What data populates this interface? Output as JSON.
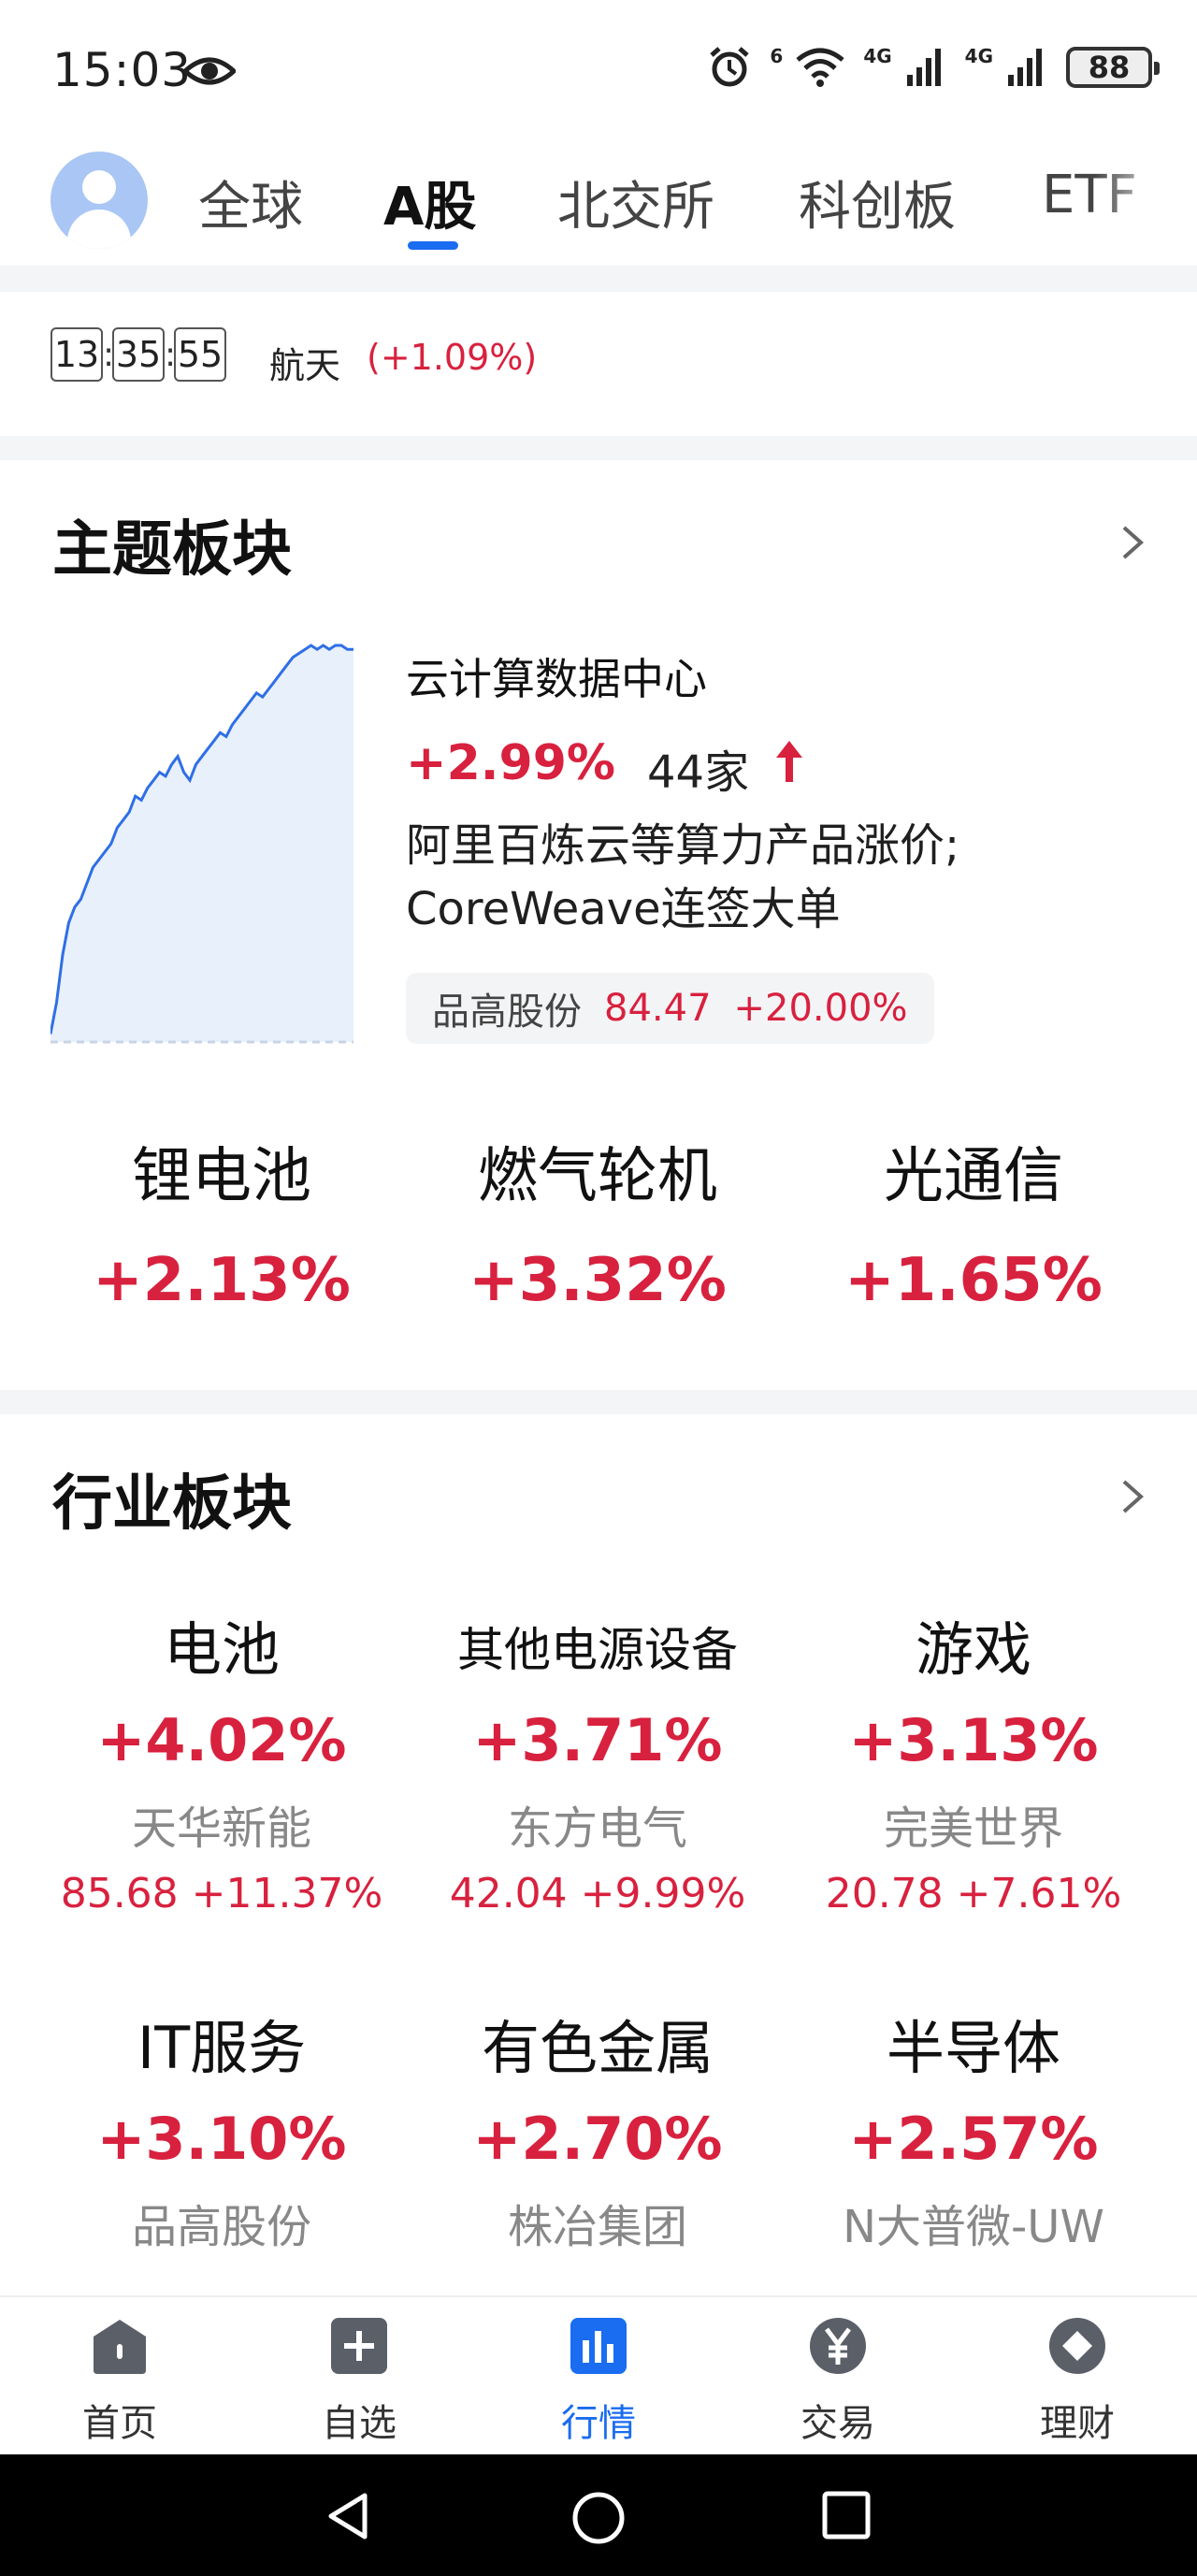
{
  "status_bar": {
    "time": "15:03",
    "signal_label_1": "4G",
    "signal_label_2": "4G",
    "wifi_label": "6",
    "battery": "88"
  },
  "tabs": [
    {
      "label": "全球"
    },
    {
      "label": "A股"
    },
    {
      "label": "北交所"
    },
    {
      "label": "科创板"
    },
    {
      "label": "ETF"
    }
  ],
  "ticker": {
    "clock_h": "13",
    "clock_m": "35",
    "clock_s": "55",
    "name": "航天",
    "change": "(+1.09%)"
  },
  "theme": {
    "title": "主题板块",
    "featured": {
      "name": "云计算数据中心",
      "change": "+2.99%",
      "count": "44家",
      "desc_line1": "阿里百炼云等算力产品涨价;",
      "desc_line2": "CoreWeave连签大单",
      "stock_name": "品高股份",
      "stock_price": "84.47",
      "stock_change": "+20.00%"
    },
    "others": [
      {
        "name": "锂电池",
        "change": "+2.13%"
      },
      {
        "name": "燃气轮机",
        "change": "+3.32%"
      },
      {
        "name": "光通信",
        "change": "+1.65%"
      }
    ]
  },
  "industry": {
    "title": "行业板块",
    "items": [
      {
        "name": "电池",
        "change": "+4.02%",
        "leader": "天华新能",
        "leader_price": "85.68 +11.37%"
      },
      {
        "name": "其他电源设备",
        "change": "+3.71%",
        "leader": "东方电气",
        "leader_price": "42.04 +9.99%"
      },
      {
        "name": "游戏",
        "change": "+3.13%",
        "leader": "完美世界",
        "leader_price": "20.78 +7.61%"
      },
      {
        "name": "IT服务",
        "change": "+3.10%",
        "leader": "品高股份",
        "leader_price": ""
      },
      {
        "name": "有色金属",
        "change": "+2.70%",
        "leader": "株冶集团",
        "leader_price": ""
      },
      {
        "name": "半导体",
        "change": "+2.57%",
        "leader": "N大普微-UW",
        "leader_price": ""
      }
    ]
  },
  "bottom_nav": [
    {
      "label": "首页"
    },
    {
      "label": "自选"
    },
    {
      "label": "行情"
    },
    {
      "label": "交易"
    },
    {
      "label": "理财"
    }
  ],
  "colors": {
    "up_red": "#d8213e",
    "accent_blue": "#1a6cf0",
    "chart_line": "#2f6fe6",
    "chart_fill": "#e8f0fc"
  },
  "chart_data": {
    "type": "area",
    "x": [
      0,
      2,
      4,
      6,
      8,
      10,
      12,
      14,
      16,
      18,
      20,
      22,
      24,
      26,
      28,
      30,
      32,
      34,
      36,
      38,
      40,
      42,
      44,
      46,
      48,
      50,
      52,
      54,
      56,
      58,
      60,
      62,
      64,
      66,
      68,
      70,
      72,
      74,
      76,
      78,
      80,
      82,
      84,
      86,
      88,
      90,
      92,
      94,
      96,
      98,
      100
    ],
    "values": [
      2,
      10,
      22,
      30,
      34,
      36,
      40,
      44,
      46,
      48,
      50,
      54,
      56,
      58,
      62,
      61,
      64,
      66,
      68,
      67,
      70,
      72,
      68,
      66,
      70,
      72,
      74,
      76,
      78,
      77,
      80,
      82,
      84,
      86,
      88,
      87,
      89,
      91,
      93,
      95,
      97,
      98,
      99,
      100,
      99,
      100,
      99,
      100,
      100,
      99,
      99
    ]
  }
}
